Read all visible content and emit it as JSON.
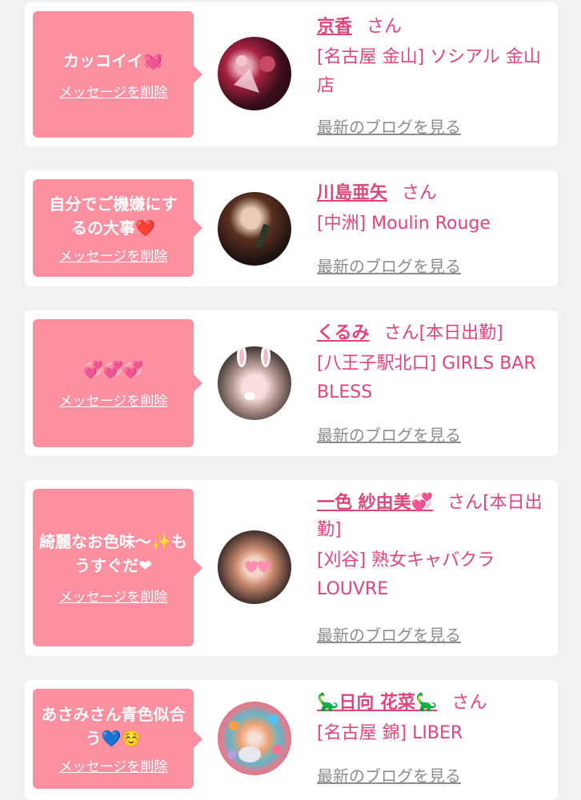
{
  "cards": [
    {
      "message": "カッコイイ",
      "emoji": "💓",
      "delete_label": "メッセージを削除",
      "name": "京香",
      "honorific": "さん",
      "shop": "[名古屋 金山] ソシアル 金山店",
      "blog_label": "最新のブログを見る"
    },
    {
      "message": "自分でご機嫌にするの大事",
      "emoji": "❤️",
      "delete_label": "メッセージを削除",
      "name": "川島亜矢",
      "honorific": "さん",
      "shop": "[中洲] Moulin Rouge",
      "blog_label": "最新のブログを見る"
    },
    {
      "message": "",
      "emoji": "💞💞💞",
      "delete_label": "メッセージを削除",
      "name": "くるみ",
      "honorific": "さん[本日出勤]",
      "shop": "[八王子駅北口] GIRLS BAR BLESS",
      "blog_label": "最新のブログを見る"
    },
    {
      "message": "綺麗なお色味〜✨もうすぐだ",
      "emoji": "❤",
      "delete_label": "メッセージを削除",
      "name": "一色 紗由美",
      "name_emoji": "💞",
      "honorific": "さん[本日出勤]",
      "shop": "[刈谷] 熟女キャバクラ LOUVRE",
      "blog_label": "最新のブログを見る"
    },
    {
      "message": "あさみさん青色似合う",
      "emoji": "💙☺️",
      "delete_label": "メッセージを削除",
      "name": "🦕日向 花菜🦕",
      "honorific": "さん",
      "shop": "[名古屋 錦] LIBER",
      "blog_label": "最新のブログを見る"
    }
  ],
  "colors": {
    "background": "#f1f1f1",
    "card": "#ffffff",
    "bubble": "#fc90a0",
    "name": "#e0457a",
    "blog_link": "#8c8c8c"
  },
  "icons": [
    "heart-icon",
    "avatar-photo"
  ]
}
